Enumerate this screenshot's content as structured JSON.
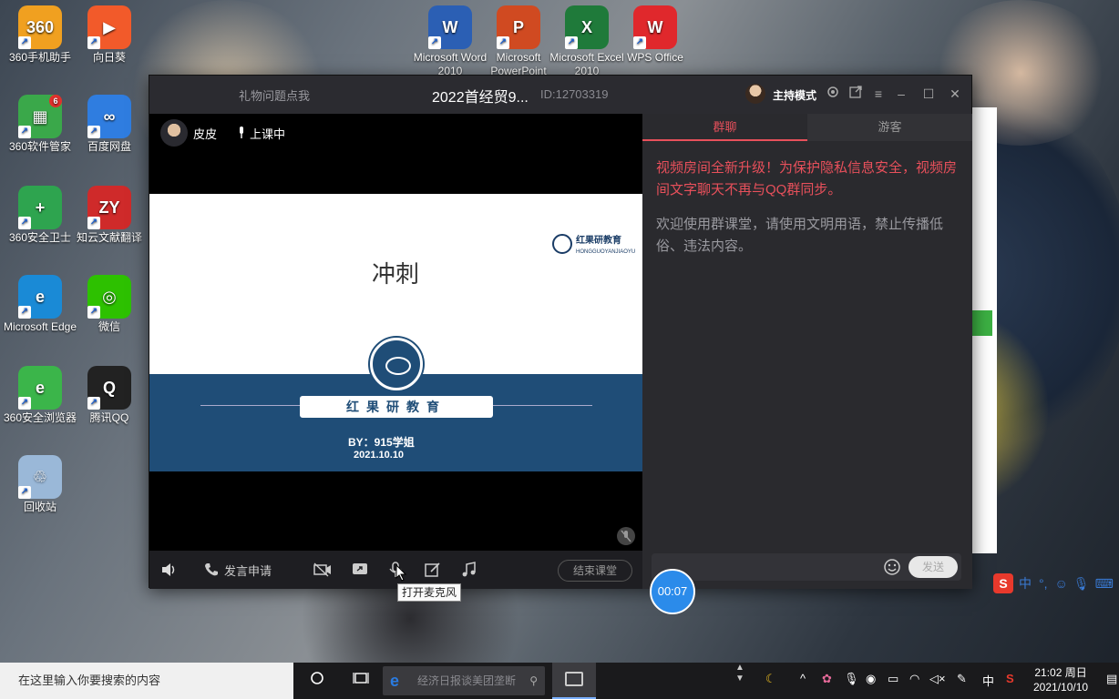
{
  "desktop": {
    "icons": [
      {
        "label": "360手机助手",
        "color": "#f0a020",
        "glyph": "360"
      },
      {
        "label": "向日葵",
        "color": "#f25a2a",
        "glyph": "▶"
      },
      {
        "label": "Microsoft Word 2010",
        "color": "#2b5fb4",
        "glyph": "W"
      },
      {
        "label": "Microsoft PowerPoint",
        "color": "#d04a21",
        "glyph": "P"
      },
      {
        "label": "Microsoft Excel 2010",
        "color": "#1f7a3a",
        "glyph": "X"
      },
      {
        "label": "WPS Office",
        "color": "#e0282c",
        "glyph": "W"
      },
      {
        "label": "360软件管家",
        "color": "#3aa84a",
        "glyph": "▦",
        "badge": "6"
      },
      {
        "label": "百度网盘",
        "color": "#2f7de0",
        "glyph": "∞"
      },
      {
        "label": "360安全卫士",
        "color": "#2ea44f",
        "glyph": "+"
      },
      {
        "label": "知云文献翻译",
        "color": "#cf2a2a",
        "glyph": "ZY"
      },
      {
        "label": "Microsoft Edge",
        "color": "#1a8ad6",
        "glyph": "e"
      },
      {
        "label": "微信",
        "color": "#2dc100",
        "glyph": "◎"
      },
      {
        "label": "360安全浏览器",
        "color": "#3bb54a",
        "glyph": "e"
      },
      {
        "label": "腾讯QQ",
        "color": "#222222",
        "glyph": "Q"
      },
      {
        "label": "回收站",
        "color": "#9ab8d8",
        "glyph": "♲"
      }
    ]
  },
  "window": {
    "gift_label": "礼物问题点我",
    "title": "2022首经贸9...",
    "room_id": "ID:12703319",
    "host_mode": "主持模式"
  },
  "video": {
    "presenter_name": "皮皮",
    "status": "上课中"
  },
  "slide": {
    "heading": "冲刺",
    "brand_small": "红果研教育",
    "brand_small_sub": "HONGGUOYANJIAOYU",
    "org_name": "红果研教育",
    "by_line": "BY：915学姐",
    "date": "2021.10.10"
  },
  "controls": {
    "apply_speak": "发言申请",
    "end_class": "结束课堂",
    "tooltip": "打开麦克风",
    "timer": "00:07"
  },
  "chat": {
    "tabs": [
      "群聊",
      "游客"
    ],
    "active_tab": 0,
    "notice_red": "视频房间全新升级！为保护隐私信息安全，视频房间文字聊天不再与QQ群同步。",
    "notice_gray": "欢迎使用群课堂，请使用文明用语，禁止传播低俗、违法内容。",
    "send_label": "发送"
  },
  "ime": {
    "lang": "中"
  },
  "taskbar": {
    "search_placeholder": "在这里输入你要搜索的内容",
    "browser_hint": "经济日报谈美团垄断",
    "tray_lang": "中",
    "time": "21:02 周日",
    "date": "2021/10/10"
  },
  "colors": {
    "accent_red": "#e8505b",
    "timer_blue": "#2b8bea",
    "slide_navy": "#1f4d77"
  }
}
